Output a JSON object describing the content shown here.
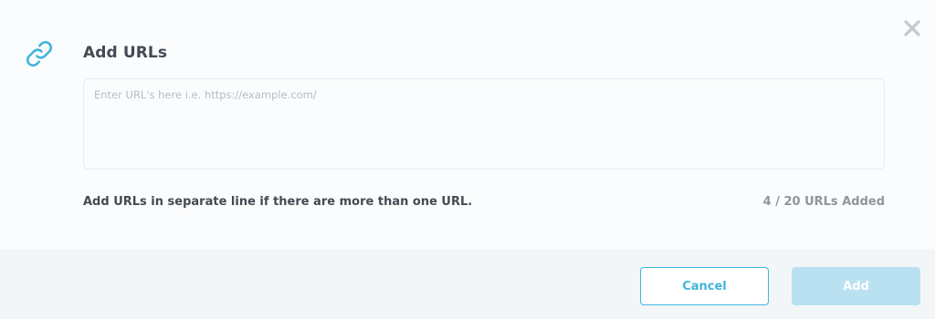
{
  "dialog": {
    "title": "Add URLs",
    "close_icon": "close-icon",
    "link_icon": "link-icon"
  },
  "input": {
    "value": "",
    "placeholder": "Enter URL's here i.e. https://example.com/"
  },
  "help_text": "Add URLs in separate line if there are more than one URL.",
  "counter": {
    "added": 4,
    "max": 20,
    "text": "4 / 20 URLs Added"
  },
  "buttons": {
    "cancel_label": "Cancel",
    "add_label": "Add"
  },
  "colors": {
    "accent": "#3fb5dc",
    "add_disabled": "#b9e1f2",
    "title_text": "#444a53",
    "muted_text": "#8e959d"
  }
}
